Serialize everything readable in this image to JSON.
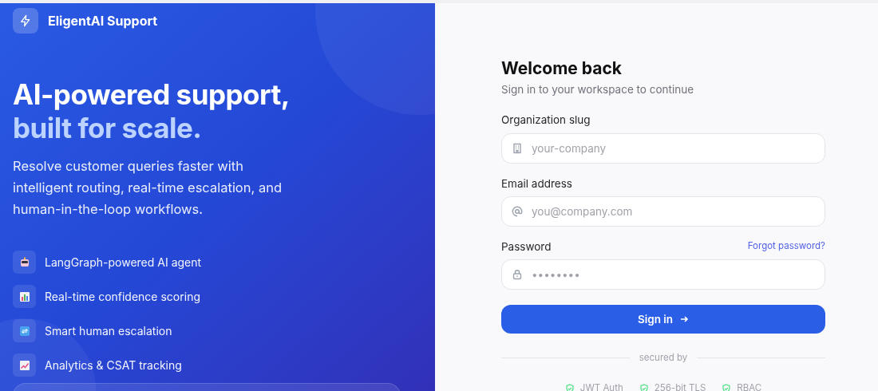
{
  "brand": {
    "name": "EligentAI Support"
  },
  "hero": {
    "headline": "AI-powered support,",
    "headline_accent": "built for scale.",
    "description": "Resolve customer queries faster with intelligent routing, real-time escalation, and human-in-the-loop workflows."
  },
  "features": [
    {
      "label": "LangGraph-powered AI agent",
      "kind": "robot"
    },
    {
      "label": "Real-time confidence scoring",
      "kind": "chart"
    },
    {
      "label": "Smart human escalation",
      "kind": "repeat"
    },
    {
      "label": "Analytics & CSAT tracking",
      "kind": "trend"
    }
  ],
  "form": {
    "title": "Welcome back",
    "subtitle": "Sign in to your workspace to continue",
    "fields": [
      {
        "label": "Organization slug",
        "placeholder": "your-company",
        "kind": "building"
      },
      {
        "label": "Email address",
        "placeholder": "you@company.com",
        "kind": "at"
      },
      {
        "label": "Password",
        "placeholder": "••••••••",
        "kind": "lock",
        "link": "Forgot password?"
      }
    ],
    "submit": "Sign in",
    "divider": "secured by",
    "badges": [
      "JWT Auth",
      "256-bit TLS",
      "RBAC"
    ]
  }
}
